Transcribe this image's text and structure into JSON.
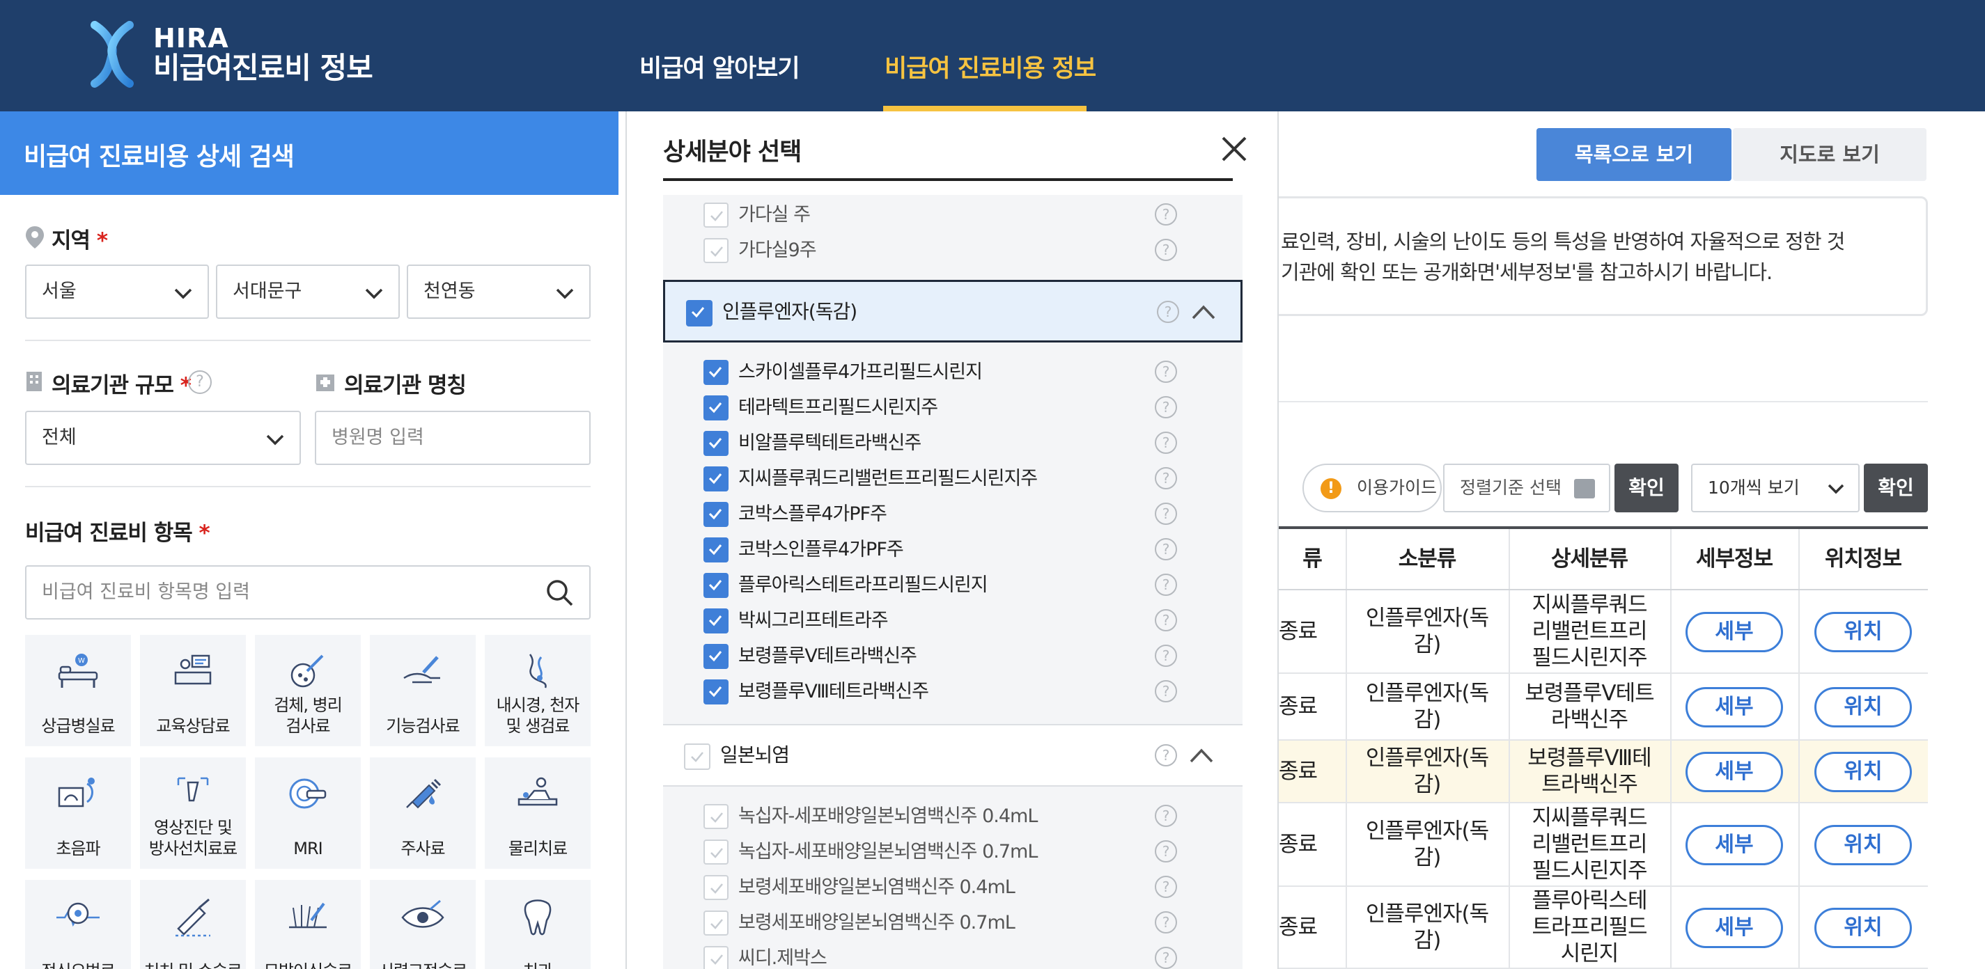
{
  "header": {
    "logo_top": "HIRA",
    "logo_bottom": "비급여진료비 정보",
    "nav": [
      {
        "label": "비급여 알아보기",
        "active": false
      },
      {
        "label": "비급여 진료비용 정보",
        "active": true
      }
    ],
    "accent": "#f6c341",
    "bg": "#1f3f6b"
  },
  "search_panel": {
    "title": "비급여 진료비용 상세 검색",
    "region_label": "지역",
    "region_required": "*",
    "region_selects": [
      "서울",
      "서대문구",
      "천연동"
    ],
    "scale_label": "의료기관 규모",
    "scale_required": "*",
    "scale_help": "?",
    "scale_value": "전체",
    "name_label": "의료기관 명칭",
    "name_placeholder": "병원명 입력",
    "items_label": "비급여 진료비 항목",
    "items_required": "*",
    "items_placeholder": "비급여 진료비 항목명 입력",
    "categories": [
      {
        "label": "상급병실료",
        "icon": "hospital-bed-icon"
      },
      {
        "label": "교육상담료",
        "icon": "counseling-desk-icon"
      },
      {
        "label": "검체, 병리\n검사료",
        "icon": "pathology-test-icon"
      },
      {
        "label": "기능검사료",
        "icon": "function-test-icon"
      },
      {
        "label": "내시경, 천자\n및 생검료",
        "icon": "endoscope-icon"
      },
      {
        "label": "초음파",
        "icon": "ultrasound-icon"
      },
      {
        "label": "영상진단 및\n방사선치료료",
        "icon": "radiology-icon"
      },
      {
        "label": "MRI",
        "icon": "mri-icon"
      },
      {
        "label": "주사료",
        "icon": "injection-icon"
      },
      {
        "label": "물리치료",
        "icon": "physical-therapy-icon"
      },
      {
        "label": "정신요법료",
        "icon": "psychotherapy-icon"
      },
      {
        "label": "처치 및 수술료",
        "icon": "surgery-icon"
      },
      {
        "label": "모발이식술료",
        "icon": "hair-transplant-icon"
      },
      {
        "label": "시력교정술료",
        "icon": "vision-correction-icon"
      },
      {
        "label": "치과",
        "icon": "tooth-icon"
      }
    ]
  },
  "results": {
    "view_list": "목록으로 보기",
    "view_map": "지도로 보기",
    "notice_line1": "료인력, 장비, 시술의 난이도 등의 특성을 반영하여 자율적으로 정한 것",
    "notice_line2": "기관에 확인 또는 공개화면'세부정보'를 참고하시기 바랍니다.",
    "guide_label": "이용가이드",
    "sort_placeholder": "정렬기준 선택",
    "confirm_label": "확인",
    "per_page": "10개씩 보기",
    "columns": [
      "류",
      "소분류",
      "상세분류",
      "세부정보",
      "위치정보"
    ],
    "rows": [
      {
        "c0": "종료",
        "small": "인플루엔자(독감)",
        "detail": "지씨플루쿼드리밸런트프리필드시린지주",
        "detail_btn": "세부",
        "loc_btn": "위치"
      },
      {
        "c0": "종료",
        "small": "인플루엔자(독감)",
        "detail": "보령플루Ⅴ테트라백신주",
        "detail_btn": "세부",
        "loc_btn": "위치"
      },
      {
        "c0": "종료",
        "small": "인플루엔자(독감)",
        "detail": "보령플루Ⅷ테트라백신주",
        "detail_btn": "세부",
        "loc_btn": "위치"
      },
      {
        "c0": "종료",
        "small": "인플루엔자(독감)",
        "detail": "지씨플루쿼드리밸런트프리필드시린지주",
        "detail_btn": "세부",
        "loc_btn": "위치"
      },
      {
        "c0": "종료",
        "small": "인플루엔자(독감)",
        "detail": "플루아릭스테트라프리필드시린지",
        "detail_btn": "세부",
        "loc_btn": "위치"
      }
    ],
    "highlight_row_color": "#fdf8e6"
  },
  "modal": {
    "title": "상세분야 선택",
    "top_items": [
      {
        "label": "가다실 주",
        "checked": false
      },
      {
        "label": "가다실9주",
        "checked": false
      }
    ],
    "group1": {
      "label": "인플루엔자(독감)",
      "checked": true
    },
    "group1_items": [
      {
        "label": "스카이셀플루4가프리필드시린지",
        "checked": true
      },
      {
        "label": "테라텍트프리필드시린지주",
        "checked": true
      },
      {
        "label": "비알플루텍테트라백신주",
        "checked": true
      },
      {
        "label": "지씨플루쿼드리밸런트프리필드시린지주",
        "checked": true
      },
      {
        "label": "코박스플루4가PF주",
        "checked": true
      },
      {
        "label": "코박스인플루4가PF주",
        "checked": true
      },
      {
        "label": "플루아릭스테트라프리필드시린지",
        "checked": true
      },
      {
        "label": "박씨그리프테트라주",
        "checked": true
      },
      {
        "label": "보령플루Ⅴ테트라백신주",
        "checked": true
      },
      {
        "label": "보령플루Ⅷ테트라백신주",
        "checked": true
      }
    ],
    "group2": {
      "label": "일본뇌염",
      "checked": false
    },
    "group2_items": [
      {
        "label": "녹십자-세포배양일본뇌염백신주 0.4mL",
        "checked": false
      },
      {
        "label": "녹십자-세포배양일본뇌염백신주 0.7mL",
        "checked": false
      },
      {
        "label": "보령세포배양일본뇌염백신주 0.4mL",
        "checked": false
      },
      {
        "label": "보령세포배양일본뇌염백신주 0.7mL",
        "checked": false
      },
      {
        "label": "씨디.제박스",
        "checked": false
      }
    ],
    "help": "?"
  }
}
